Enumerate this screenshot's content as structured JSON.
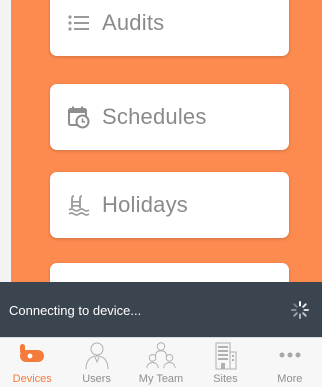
{
  "menu": {
    "items": [
      {
        "label": "Audits",
        "icon": "list-icon"
      },
      {
        "label": "Schedules",
        "icon": "calendar-clock-icon"
      },
      {
        "label": "Holidays",
        "icon": "holiday-pool-icon"
      }
    ]
  },
  "status": {
    "message": "Connecting to device...",
    "icon": "spinner-icon"
  },
  "tabbar": {
    "active": "Devices",
    "tabs": [
      {
        "label": "Devices",
        "icon": "device-lock-icon"
      },
      {
        "label": "Users",
        "icon": "user-icon"
      },
      {
        "label": "My Team",
        "icon": "team-icon"
      },
      {
        "label": "Sites",
        "icon": "building-icon"
      },
      {
        "label": "More",
        "icon": "more-dots-icon"
      }
    ]
  },
  "colors": {
    "accent": "#fd8a4f",
    "active_tab": "#f47b3a",
    "status_bar": "#3b4550",
    "card_text": "#8a8a8a",
    "inactive_tab": "#8e8e8e"
  }
}
